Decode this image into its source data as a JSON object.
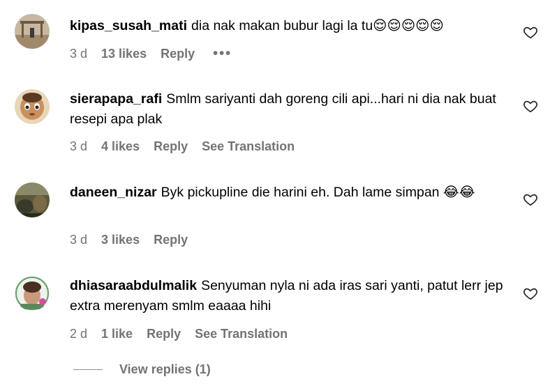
{
  "comments": [
    {
      "username": "kipas_susah_mati",
      "text": "dia nak makan bubur lagi la tu😌😌😌😌😌",
      "time": "3 d",
      "likes": "13 likes",
      "reply": "Reply",
      "more": "•••",
      "translation": ""
    },
    {
      "username": "sierapapa_rafi",
      "text": "Smlm sariyanti dah goreng cili api...hari ni dia nak buat resepi apa plak",
      "time": "3 d",
      "likes": "4 likes",
      "reply": "Reply",
      "translation": "See Translation"
    },
    {
      "username": "daneen_nizar",
      "text": "Byk pickupline die harini eh. Dah lame simpan 😂😂",
      "time": "3 d",
      "likes": "3 likes",
      "reply": "Reply",
      "translation": ""
    },
    {
      "username": "dhiasaraabdulmalik",
      "text": "Senyuman nyla ni ada iras sari yanti, patut lerr jep extra merenyam smlm eaaaa hihi",
      "time": "2 d",
      "likes": "1 like",
      "reply": "Reply",
      "translation": "See Translation"
    }
  ],
  "view_replies": "View replies (1)",
  "colors": {
    "meta": "#737373",
    "text": "#000000",
    "background": "#ffffff"
  }
}
